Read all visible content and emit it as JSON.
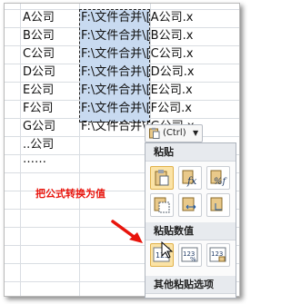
{
  "rows": [
    {
      "name": "A公司",
      "formula": "F:\\文件合并\\[A公司.x"
    },
    {
      "name": "B公司",
      "formula": "F:\\文件合并\\[B公司.x"
    },
    {
      "name": "C公司",
      "formula": "F:\\文件合并\\[C公司.x"
    },
    {
      "name": "D公司",
      "formula": "F:\\文件合并\\[D公司.x"
    },
    {
      "name": "E公司",
      "formula": "F:\\文件合并\\[E公司.x"
    },
    {
      "name": "F公司",
      "formula": "F:\\文件合并\\[F公司.x"
    },
    {
      "name": "G公司",
      "formula": "F:\\文件合并\\[G公司.x"
    }
  ],
  "more_rows": [
    "..公司",
    "……"
  ],
  "annotation": "把公式转换为值",
  "paste_options": {
    "tag_label": "(Ctrl)",
    "section_paste": "粘贴",
    "section_paste_values": "粘贴数值",
    "section_other": "其他粘贴选项",
    "paste_icons": [
      "paste-icon",
      "formula-icon",
      "percent-formula-icon",
      "no-borders-icon",
      "keep-widths-icon",
      "transpose-icon"
    ],
    "value_icons": [
      "values-icon",
      "values-number-format-icon",
      "values-source-format-icon"
    ]
  },
  "colors": {
    "selection": "#c8daf0",
    "annotation": "#e8140c",
    "highlight": "#fbe3a6",
    "grid": "#d9dde2"
  }
}
